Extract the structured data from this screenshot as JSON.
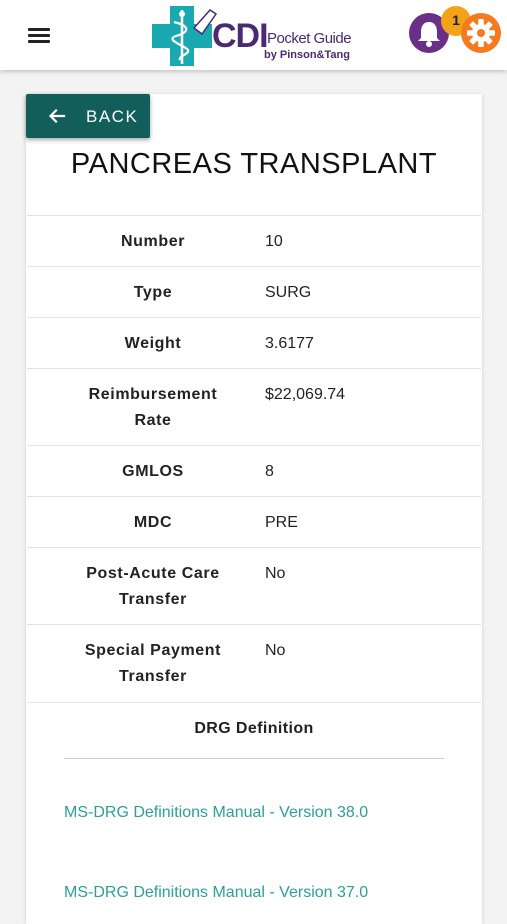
{
  "header": {
    "logo_main": "CDI",
    "logo_sub": "Pocket Guide",
    "logo_by": "by Pinson&Tang",
    "notification_count": "1",
    "colors": {
      "bell": "#6a2f87",
      "badge": "#f2a317",
      "gear": "#f47b20",
      "logo_text": "#4a2a73",
      "logo_accent": "#1aa9b0"
    },
    "icons": [
      "menu-icon",
      "bell-icon",
      "gear-icon"
    ]
  },
  "back_button": {
    "label": "BACK",
    "icon": "arrow-left-icon",
    "color": "#115e5a"
  },
  "page_title": "PANCREAS TRANSPLANT",
  "details": [
    {
      "label": "Number",
      "value": "10"
    },
    {
      "label": "Type",
      "value": "SURG"
    },
    {
      "label": "Weight",
      "value": "3.6177"
    },
    {
      "label": "Reimbursement Rate",
      "value": "$22,069.74"
    },
    {
      "label": "GMLOS",
      "value": "8"
    },
    {
      "label": "MDC",
      "value": "PRE"
    },
    {
      "label": "Post-Acute Care Transfer",
      "value": "No"
    },
    {
      "label": "Special Payment Transfer",
      "value": "No"
    }
  ],
  "definition": {
    "title": "DRG Definition",
    "links": [
      "MS-DRG Definitions Manual - Version 38.0",
      "MS-DRG Definitions Manual - Version 37.0"
    ],
    "link_color": "#2a9f9b"
  }
}
